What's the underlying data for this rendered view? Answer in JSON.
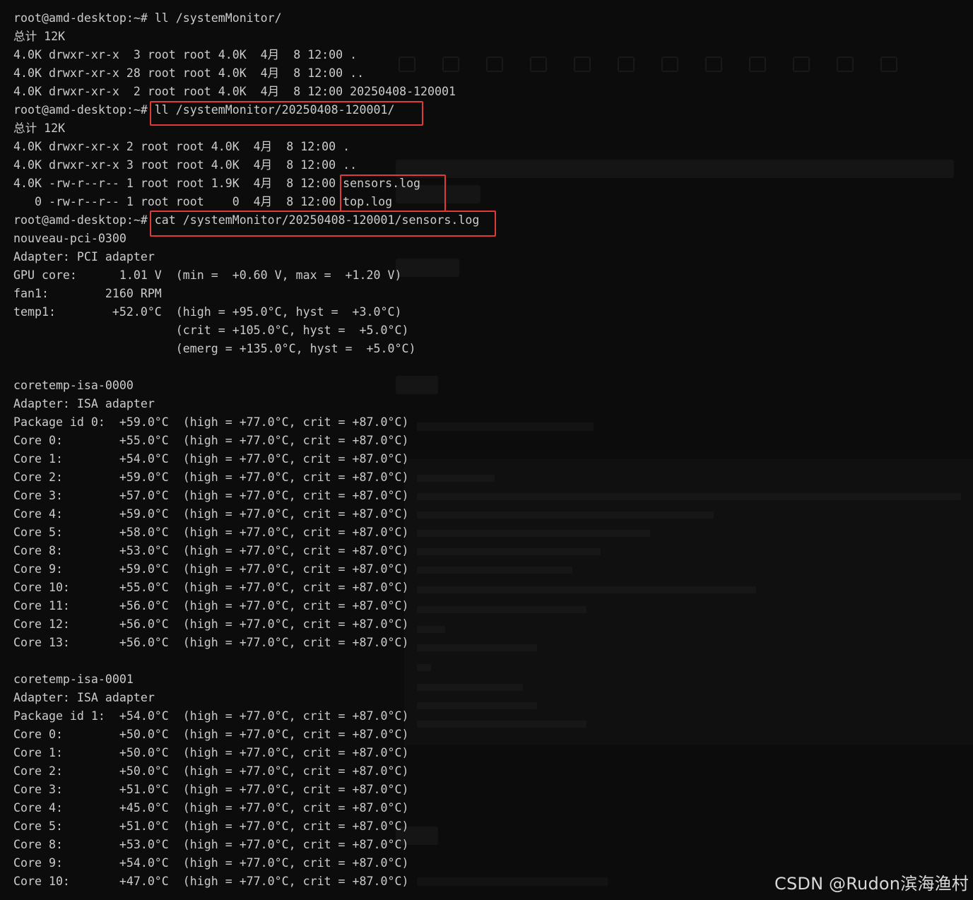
{
  "terminal": {
    "lines": [
      "root@amd-desktop:~# ll /systemMonitor/",
      "总计 12K",
      "4.0K drwxr-xr-x  3 root root 4.0K  4月  8 12:00 .",
      "4.0K drwxr-xr-x 28 root root 4.0K  4月  8 12:00 ..",
      "4.0K drwxr-xr-x  2 root root 4.0K  4月  8 12:00 20250408-120001",
      "root@amd-desktop:~# ll /systemMonitor/20250408-120001/",
      "总计 12K",
      "4.0K drwxr-xr-x 2 root root 4.0K  4月  8 12:00 .",
      "4.0K drwxr-xr-x 3 root root 4.0K  4月  8 12:00 ..",
      "4.0K -rw-r--r-- 1 root root 1.9K  4月  8 12:00 sensors.log",
      "   0 -rw-r--r-- 1 root root    0  4月  8 12:00 top.log",
      "root@amd-desktop:~# cat /systemMonitor/20250408-120001/sensors.log",
      "nouveau-pci-0300",
      "Adapter: PCI adapter",
      "GPU core:      1.01 V  (min =  +0.60 V, max =  +1.20 V)",
      "fan1:        2160 RPM",
      "temp1:        +52.0°C  (high = +95.0°C, hyst =  +3.0°C)",
      "                       (crit = +105.0°C, hyst =  +5.0°C)",
      "                       (emerg = +135.0°C, hyst =  +5.0°C)",
      "",
      "coretemp-isa-0000",
      "Adapter: ISA adapter",
      "Package id 0:  +59.0°C  (high = +77.0°C, crit = +87.0°C)",
      "Core 0:        +55.0°C  (high = +77.0°C, crit = +87.0°C)",
      "Core 1:        +54.0°C  (high = +77.0°C, crit = +87.0°C)",
      "Core 2:        +59.0°C  (high = +77.0°C, crit = +87.0°C)",
      "Core 3:        +57.0°C  (high = +77.0°C, crit = +87.0°C)",
      "Core 4:        +59.0°C  (high = +77.0°C, crit = +87.0°C)",
      "Core 5:        +58.0°C  (high = +77.0°C, crit = +87.0°C)",
      "Core 8:        +53.0°C  (high = +77.0°C, crit = +87.0°C)",
      "Core 9:        +59.0°C  (high = +77.0°C, crit = +87.0°C)",
      "Core 10:       +55.0°C  (high = +77.0°C, crit = +87.0°C)",
      "Core 11:       +56.0°C  (high = +77.0°C, crit = +87.0°C)",
      "Core 12:       +56.0°C  (high = +77.0°C, crit = +87.0°C)",
      "Core 13:       +56.0°C  (high = +77.0°C, crit = +87.0°C)",
      "",
      "coretemp-isa-0001",
      "Adapter: ISA adapter",
      "Package id 1:  +54.0°C  (high = +77.0°C, crit = +87.0°C)",
      "Core 0:        +50.0°C  (high = +77.0°C, crit = +87.0°C)",
      "Core 1:        +50.0°C  (high = +77.0°C, crit = +87.0°C)",
      "Core 2:        +50.0°C  (high = +77.0°C, crit = +87.0°C)",
      "Core 3:        +51.0°C  (high = +77.0°C, crit = +87.0°C)",
      "Core 4:        +45.0°C  (high = +77.0°C, crit = +87.0°C)",
      "Core 5:        +51.0°C  (high = +77.0°C, crit = +87.0°C)",
      "Core 8:        +53.0°C  (high = +77.0°C, crit = +87.0°C)",
      "Core 9:        +54.0°C  (high = +77.0°C, crit = +87.0°C)",
      "Core 10:       +47.0°C  (high = +77.0°C, crit = +87.0°C)"
    ]
  },
  "watermark": "CSDN @Rudon滨海渔村",
  "colors": {
    "background": "#0c0c0c",
    "text": "#cccccc",
    "highlight": "#e03a3a"
  }
}
